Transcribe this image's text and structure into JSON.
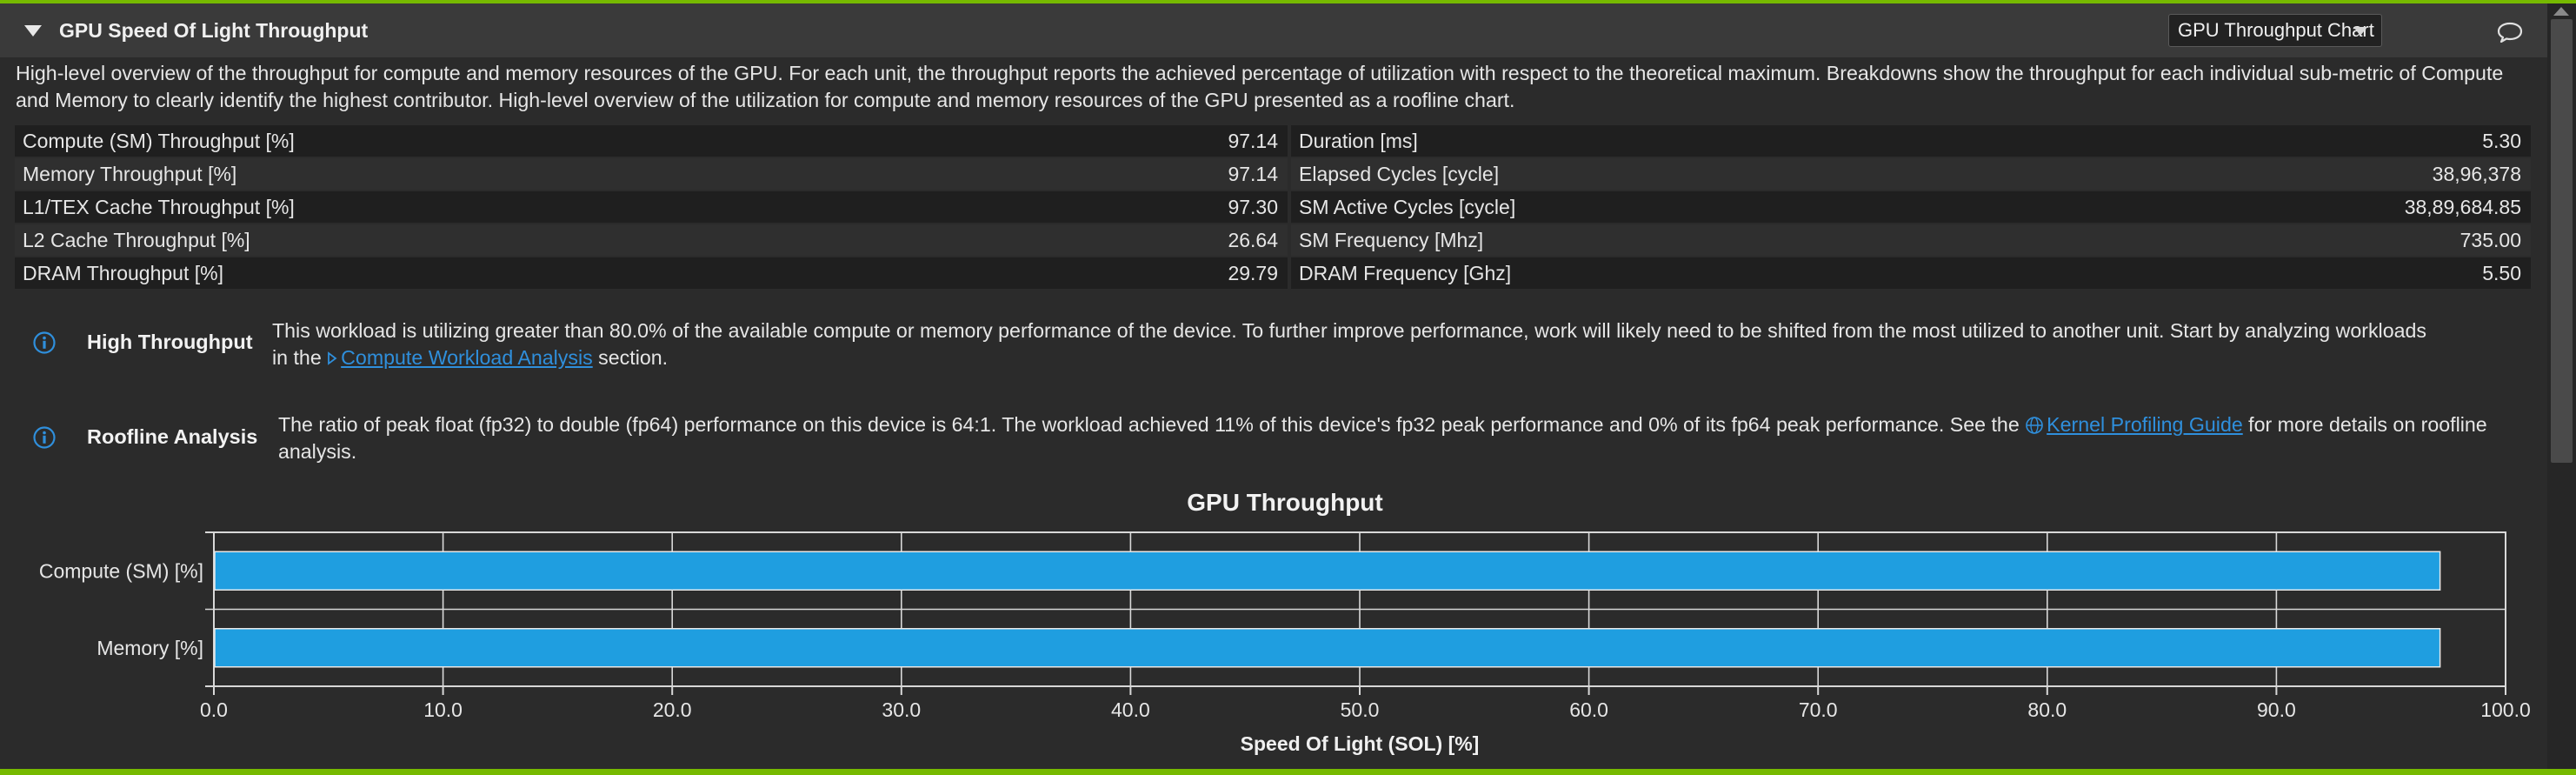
{
  "section": {
    "title": "GPU Speed Of Light Throughput",
    "view_select": "GPU Throughput Chart"
  },
  "description": "High-level overview of the throughput for compute and memory resources of the GPU. For each unit, the throughput reports the achieved percentage of utilization with respect to the theoretical maximum. Breakdowns show the throughput for each individual sub-metric of Compute and Memory to clearly identify the highest contributor. High-level overview of the utilization for compute and memory resources of the GPU presented as a roofline chart.",
  "metrics": [
    {
      "label": "Compute (SM) Throughput [%]",
      "value": "97.14",
      "label2": "Duration [ms]",
      "value2": "5.30"
    },
    {
      "label": "Memory Throughput [%]",
      "value": "97.14",
      "label2": "Elapsed Cycles [cycle]",
      "value2": "38,96,378"
    },
    {
      "label": "L1/TEX Cache Throughput [%]",
      "value": "97.30",
      "label2": "SM Active Cycles [cycle]",
      "value2": "38,89,684.85"
    },
    {
      "label": "L2 Cache Throughput [%]",
      "value": "26.64",
      "label2": "SM Frequency [Mhz]",
      "value2": "735.00"
    },
    {
      "label": "DRAM Throughput [%]",
      "value": "29.79",
      "label2": "DRAM Frequency [Ghz]",
      "value2": "5.50"
    }
  ],
  "messages": {
    "high_throughput": {
      "title": "High Throughput",
      "text_before": "This workload is utilizing greater than 80.0% of the available compute or memory performance of the device. To further improve performance, work will likely need to be shifted from the most utilized to another unit. Start by analyzing workloads in the ",
      "link": "Compute Workload Analysis",
      "text_after": " section."
    },
    "roofline": {
      "title": "Roofline Analysis",
      "text_before": "The ratio of peak float (fp32) to double (fp64) performance on this device is 64:1. The workload achieved 11% of this device's fp32 peak performance and 0% of its fp64 peak performance. See the ",
      "link": "Kernel Profiling Guide",
      "text_after": " for more details on roofline analysis."
    }
  },
  "colors": {
    "accent": "#76b900",
    "bar": "#1f9ee0",
    "link": "#2f8fdc"
  },
  "icons": {
    "collapse": "triangle-down-icon",
    "dropdown": "chevron-down-icon",
    "comment": "speech-bubble-icon",
    "info": "info-circle-icon",
    "link_arrow": "play-arrow-icon",
    "link_globe": "globe-icon"
  },
  "chart_data": {
    "type": "bar",
    "orientation": "horizontal",
    "title": "GPU Throughput",
    "categories": [
      "Compute (SM) [%]",
      "Memory [%]"
    ],
    "values": [
      97.14,
      97.14
    ],
    "xlabel": "Speed Of Light (SOL) [%]",
    "ylabel": "",
    "xlim": [
      0,
      100
    ],
    "xticks": [
      "0.0",
      "10.0",
      "20.0",
      "30.0",
      "40.0",
      "50.0",
      "60.0",
      "70.0",
      "80.0",
      "90.0",
      "100.0"
    ],
    "grid": true
  }
}
